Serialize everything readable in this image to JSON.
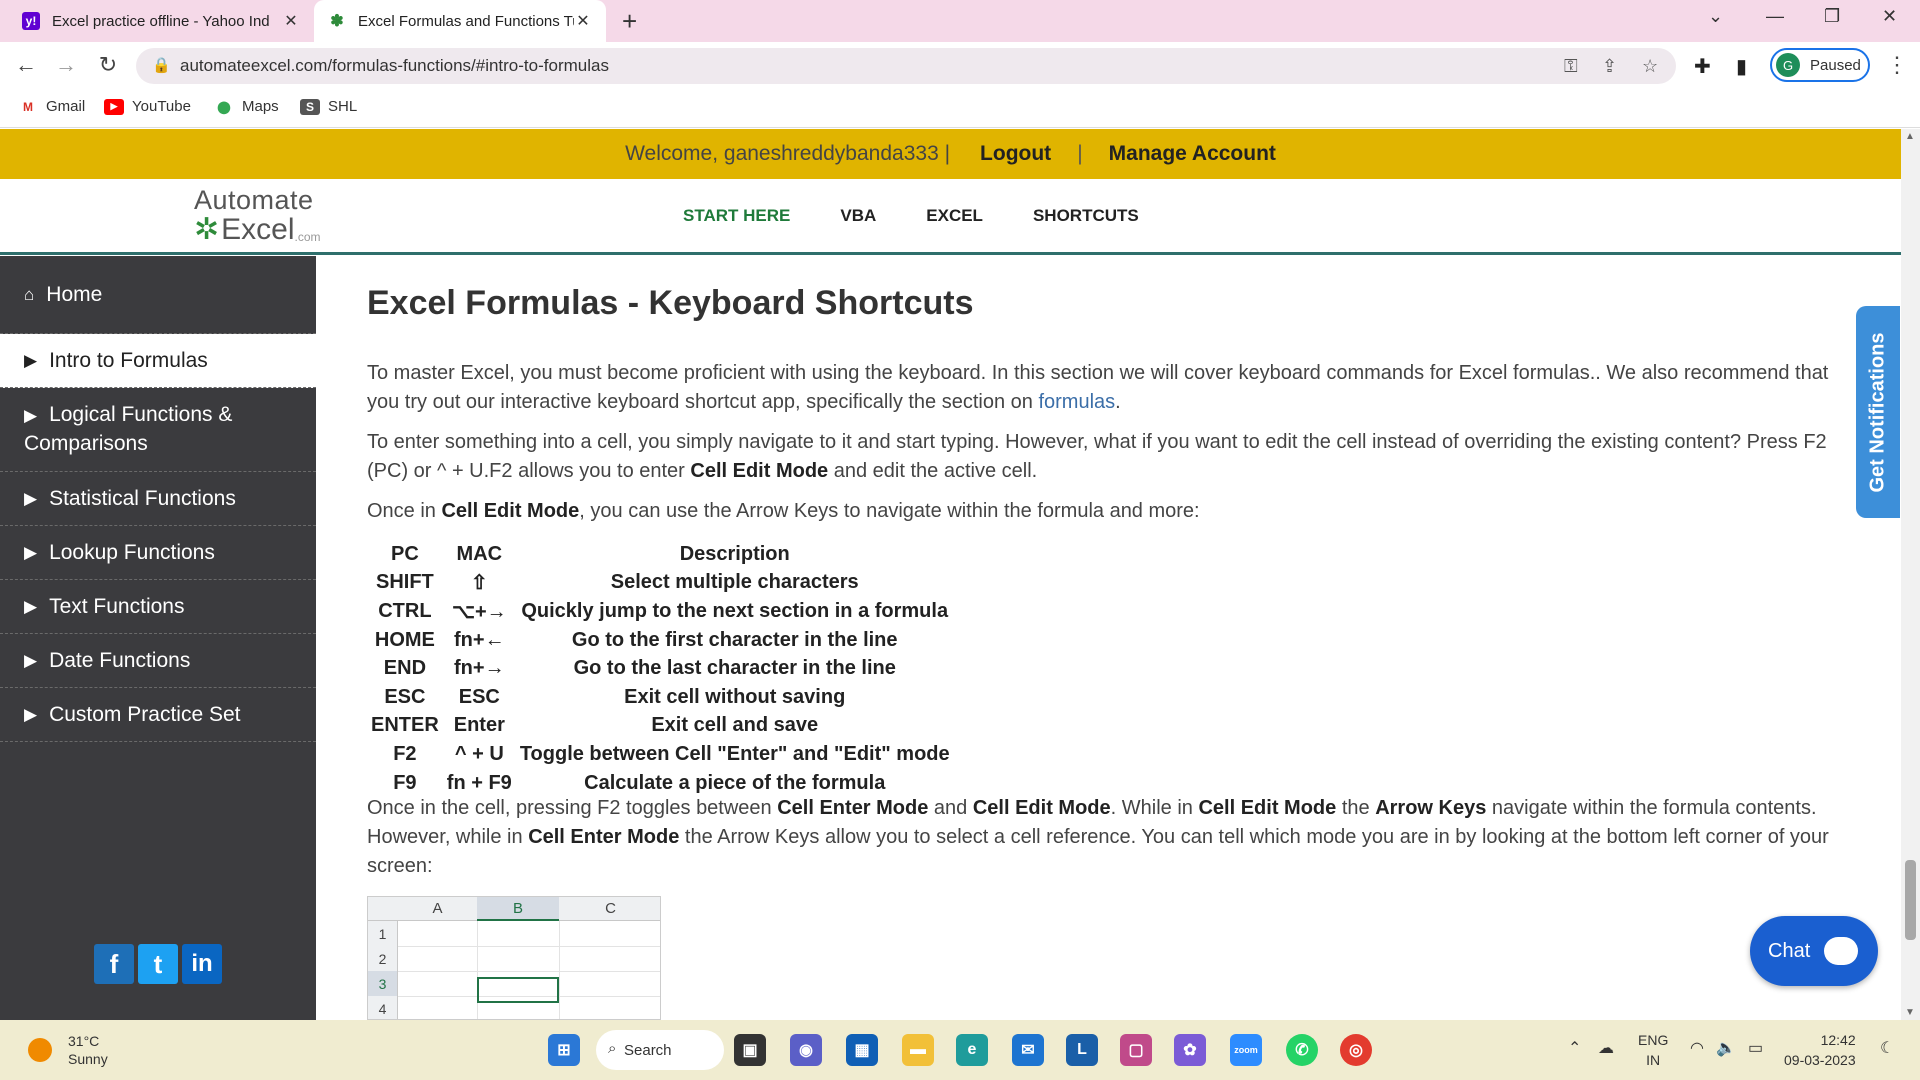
{
  "browser": {
    "tabs": [
      {
        "title": "Excel practice offline - Yahoo Ind",
        "favicon": "yahoo-icon"
      },
      {
        "title": "Excel Formulas and Functions Tu",
        "favicon": "automateexcel-icon"
      }
    ],
    "url": "automateexcel.com/formulas-functions/#intro-to-formulas",
    "profile": {
      "initial": "G",
      "status": "Paused"
    },
    "bookmarks": [
      {
        "label": "Gmail",
        "icon": "gmail-icon"
      },
      {
        "label": "YouTube",
        "icon": "youtube-icon"
      },
      {
        "label": "Maps",
        "icon": "maps-icon"
      },
      {
        "label": "SHL",
        "icon": "shl-icon"
      }
    ]
  },
  "welcome": {
    "text": "Welcome, ganeshreddybanda333 |",
    "logout": "Logout",
    "separator": "|",
    "manage": "Manage Account"
  },
  "logo": {
    "line1": "Automate",
    "line2": "Excel",
    "suffix": ".com"
  },
  "nav": {
    "items": [
      "START HERE",
      "VBA",
      "EXCEL",
      "SHORTCUTS"
    ],
    "active": "START HERE"
  },
  "sidebar": {
    "home": "Home",
    "items": [
      "Intro to Formulas",
      "Logical Functions & Comparisons",
      "Statistical Functions",
      "Lookup Functions",
      "Text Functions",
      "Date Functions",
      "Custom Practice Set"
    ],
    "current": "Intro to Formulas"
  },
  "article": {
    "title": "Excel Formulas - Keyboard Shortcuts",
    "p1_before": "To master Excel, you must become proficient with using the keyboard. In this section we will cover keyboard commands for Excel formulas.. We also recommend that you try out our interactive keyboard shortcut app, specifically the section on ",
    "p1_link": "formulas",
    "p1_after": ".",
    "p2_before": "To enter something into a cell, you simply navigate to it and start typing. However, what if you want to edit the cell instead of overriding the existing content? Press F2 (PC) or ^ + U.F2 allows you to enter ",
    "p2_bold": "Cell Edit Mode",
    "p2_after": " and edit the active cell.",
    "p3_before": "Once in ",
    "p3_bold": "Cell Edit Mode",
    "p3_after": ", you can use the Arrow Keys to navigate within the formula and more:",
    "table_headers": [
      "PC",
      "MAC",
      "Description"
    ],
    "table_rows": [
      [
        "SHIFT",
        "⇧",
        "Select multiple characters"
      ],
      [
        "CTRL",
        "⌥+→",
        "Quickly jump to the next section in a formula"
      ],
      [
        "HOME",
        "fn+←",
        "Go to the first character in the line"
      ],
      [
        "END",
        "fn+→",
        "Go to the last character in the line"
      ],
      [
        "ESC",
        "ESC",
        "Exit cell without saving"
      ],
      [
        "ENTER",
        "Enter",
        "Exit cell and save"
      ],
      [
        "F2",
        "^ + U",
        "Toggle between Cell \"Enter\" and \"Edit\" mode"
      ],
      [
        "F9",
        "fn + F9",
        "Calculate a piece of the formula"
      ]
    ],
    "p4_a": "Once in the cell, pressing F2 toggles between ",
    "p4_b": "Cell Enter Mode",
    "p4_c": " and ",
    "p4_d": "Cell Edit Mode",
    "p4_e": ". While in ",
    "p4_f": "Cell Edit Mode",
    "p4_g": " the ",
    "p4_h": "Arrow Keys",
    "p4_i": " navigate within the formula contents. However, while in ",
    "p4_j": "Cell Enter Mode",
    "p4_k": " the Arrow Keys allow you to select a cell reference. You can tell which mode you are in by looking at the bottom left corner of your screen:",
    "grid": {
      "columns": [
        "A",
        "B",
        "C"
      ],
      "rows": [
        "1",
        "2",
        "3",
        "4"
      ]
    }
  },
  "widgets": {
    "notifications": "Get Notifications",
    "chat": "Chat"
  },
  "taskbar": {
    "weather_temp": "31°C",
    "weather_desc": "Sunny",
    "search": "Search",
    "lang1": "ENG",
    "lang2": "IN",
    "time": "12:42",
    "date": "09-03-2023"
  },
  "colors": {
    "accent_bar": "#e0b400",
    "sidebar": "#3b3b3e",
    "nav_active": "#1f7a3a",
    "link": "#3b6ea8",
    "chat": "#1a5fd0"
  }
}
